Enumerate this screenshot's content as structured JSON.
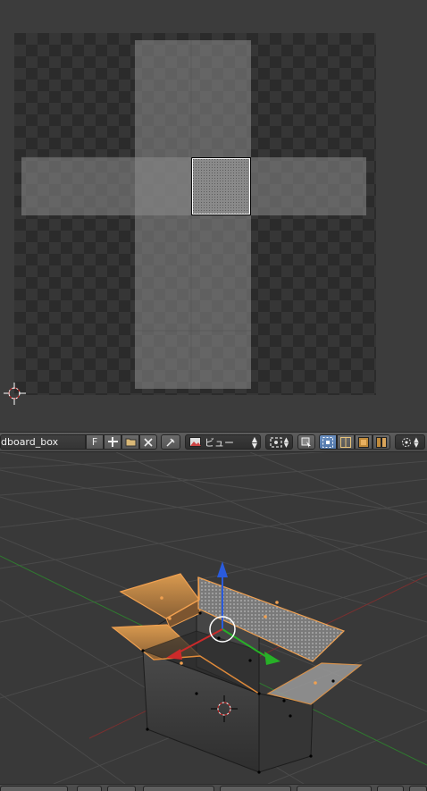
{
  "uv_editor": {
    "image_name": "dboard_box",
    "fake_user_label": "F",
    "view_menu_label": "ビュー"
  },
  "icons": {
    "new_image": "plus-icon",
    "open_image": "folder-icon",
    "unlink_image": "x-icon",
    "pin": "pin-icon",
    "view_mode": "image-icon",
    "snap": "snap-icon",
    "sticky": "sticky-icon",
    "select_mode": [
      "vertex-select-icon",
      "edge-select-icon",
      "face-select-icon",
      "island-select-icon"
    ],
    "pivot": "pivot-icon",
    "cursor": "3d-cursor-icon"
  },
  "colors": {
    "selection": "#e0a050",
    "selected_face": "#f0a050",
    "axis_x": "#cc2a2a",
    "axis_y": "#27b027",
    "axis_z": "#2a5bdc",
    "active_button": "#5680c2"
  }
}
